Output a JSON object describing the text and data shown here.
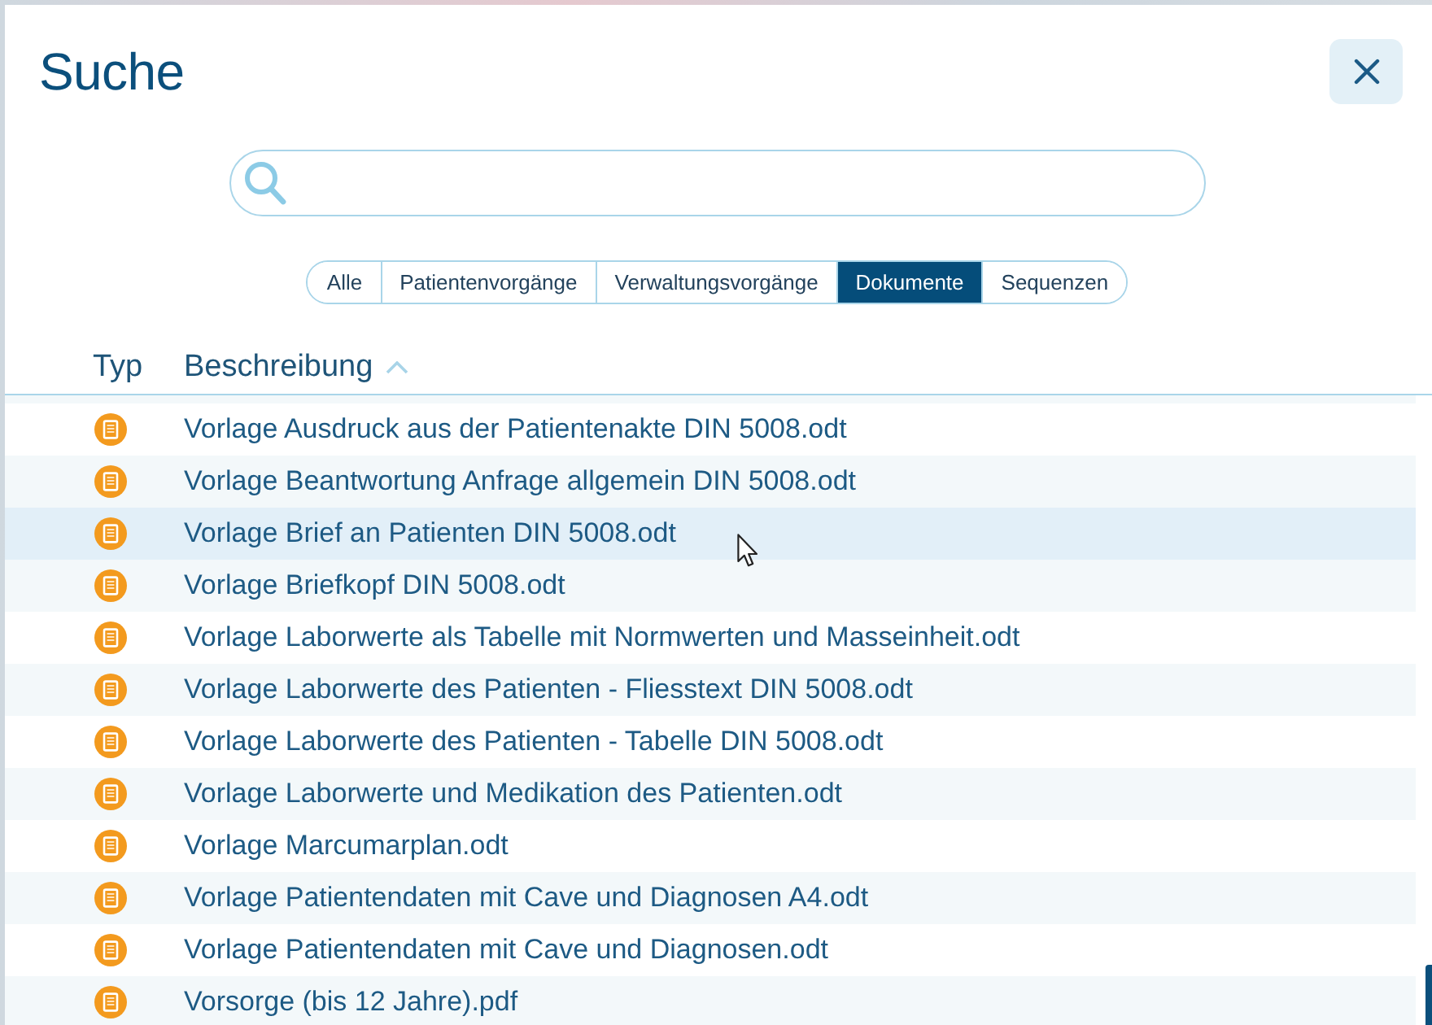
{
  "dialog": {
    "title": "Suche"
  },
  "filter_tabs": [
    {
      "label": "Alle",
      "selected": false
    },
    {
      "label": "Patientenvorgänge",
      "selected": false
    },
    {
      "label": "Verwaltungsvorgänge",
      "selected": false
    },
    {
      "label": "Dokumente",
      "selected": true
    },
    {
      "label": "Sequenzen",
      "selected": false
    }
  ],
  "table": {
    "columns": [
      {
        "label": "Typ",
        "sorted": false
      },
      {
        "label": "Beschreibung",
        "sorted": true
      }
    ],
    "rows": [
      {
        "kind": "document",
        "description": "Vorlage Ausdruck aus der Patientenakte DIN 5008.odt",
        "highlighted": false
      },
      {
        "kind": "document",
        "description": "Vorlage Beantwortung Anfrage allgemein DIN 5008.odt",
        "highlighted": false
      },
      {
        "kind": "document",
        "description": "Vorlage Brief an Patienten DIN 5008.odt",
        "highlighted": true
      },
      {
        "kind": "document",
        "description": "Vorlage Briefkopf DIN 5008.odt",
        "highlighted": false
      },
      {
        "kind": "document",
        "description": "Vorlage Laborwerte als Tabelle mit Normwerten und Masseinheit.odt",
        "highlighted": false
      },
      {
        "kind": "document",
        "description": "Vorlage Laborwerte des Patienten - Fliesstext DIN 5008.odt",
        "highlighted": false
      },
      {
        "kind": "document",
        "description": "Vorlage Laborwerte des Patienten - Tabelle DIN 5008.odt",
        "highlighted": false
      },
      {
        "kind": "document",
        "description": "Vorlage Laborwerte und Medikation des Patienten.odt",
        "highlighted": false
      },
      {
        "kind": "document",
        "description": "Vorlage Marcumarplan.odt",
        "highlighted": false
      },
      {
        "kind": "document",
        "description": "Vorlage Patientendaten mit Cave und Diagnosen A4.odt",
        "highlighted": false
      },
      {
        "kind": "document",
        "description": "Vorlage Patientendaten mit Cave und Diagnosen.odt",
        "highlighted": false
      },
      {
        "kind": "document",
        "description": "Vorsorge (bis 12 Jahre).pdf",
        "highlighted": false
      }
    ]
  }
}
